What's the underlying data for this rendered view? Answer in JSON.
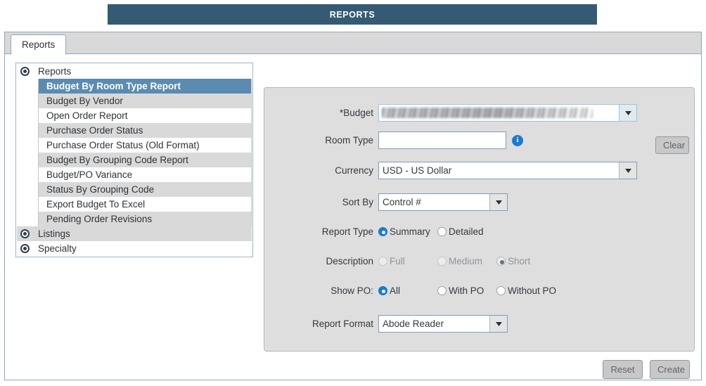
{
  "header": {
    "title": "REPORTS"
  },
  "tabs": [
    {
      "label": "Reports",
      "active": true
    }
  ],
  "tree": {
    "groups": [
      {
        "name": "reports",
        "label": "Reports",
        "icon": "node-expanded-icon"
      },
      {
        "name": "listings",
        "label": "Listings",
        "icon": "node-collapsed-icon"
      },
      {
        "name": "specialty",
        "label": "Specialty",
        "icon": "node-collapsed-icon"
      }
    ],
    "report_items": [
      {
        "label": "Budget By Room Type Report",
        "selected": true
      },
      {
        "label": "Budget By Vendor",
        "selected": false
      },
      {
        "label": "Open Order Report",
        "selected": false
      },
      {
        "label": "Purchase Order Status",
        "selected": false
      },
      {
        "label": "Purchase Order Status (Old Format)",
        "selected": false
      },
      {
        "label": "Budget By Grouping Code Report",
        "selected": false
      },
      {
        "label": "Budget/PO Variance",
        "selected": false
      },
      {
        "label": "Status By Grouping Code",
        "selected": false
      },
      {
        "label": "Export Budget To Excel",
        "selected": false
      },
      {
        "label": "Pending Order Revisions",
        "selected": false
      }
    ]
  },
  "form": {
    "budget": {
      "label": "*Budget",
      "value": "",
      "redacted": true,
      "clear_label": "Clear"
    },
    "room_type": {
      "label": "Room Type",
      "value": "",
      "placeholder": "",
      "info_icon": "info-icon",
      "info_glyph": "i"
    },
    "currency": {
      "label": "Currency",
      "value": "USD - US Dollar"
    },
    "sort_by": {
      "label": "Sort By",
      "value": "Control #"
    },
    "report_type": {
      "label": "Report Type",
      "options": [
        {
          "label": "Summary",
          "selected": true,
          "disabled": false
        },
        {
          "label": "Detailed",
          "selected": false,
          "disabled": false
        }
      ]
    },
    "description": {
      "label": "Description",
      "options": [
        {
          "label": "Full",
          "selected": false,
          "disabled": true
        },
        {
          "label": "Medium",
          "selected": false,
          "disabled": true
        },
        {
          "label": "Short",
          "selected": true,
          "disabled": true
        }
      ]
    },
    "show_po": {
      "label": "Show PO:",
      "options": [
        {
          "label": "All",
          "selected": true,
          "disabled": false
        },
        {
          "label": "With PO",
          "selected": false,
          "disabled": false
        },
        {
          "label": "Without PO",
          "selected": false,
          "disabled": false
        }
      ]
    },
    "report_format": {
      "label": "Report Format",
      "value": "Abode Reader"
    }
  },
  "footer": {
    "reset_label": "Reset",
    "create_label": "Create"
  },
  "colors": {
    "header_bar": "#345b73",
    "selected_row": "#5b8bb0",
    "accent_radio": "#1a7ad4",
    "panel_bg": "#dedede",
    "stripe": "#d9d9d9"
  }
}
